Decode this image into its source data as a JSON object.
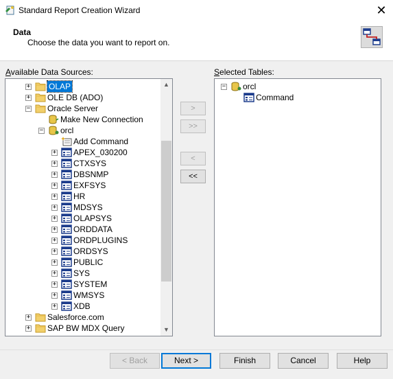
{
  "window": {
    "title": "Standard Report Creation Wizard",
    "close_glyph": "✕"
  },
  "header": {
    "title": "Data",
    "subtitle": "Choose the data you want to report on."
  },
  "available": {
    "label_accel": "A",
    "label_rest": "vailable Data Sources:",
    "items": [
      {
        "label": "OLAP",
        "type": "folder",
        "expander": "+"
      },
      {
        "label": "OLE DB (ADO)",
        "type": "folder",
        "expander": "+"
      },
      {
        "label": "Oracle Server",
        "type": "folder",
        "expander": "−"
      },
      {
        "label": "Make New Connection",
        "type": "make-connection"
      },
      {
        "label": "orcl",
        "type": "database",
        "expander": "−"
      },
      {
        "label": "Add Command",
        "type": "add-command"
      },
      {
        "label": "APEX_030200",
        "type": "table",
        "expander": "+"
      },
      {
        "label": "CTXSYS",
        "type": "table",
        "expander": "+"
      },
      {
        "label": "DBSNMP",
        "type": "table",
        "expander": "+"
      },
      {
        "label": "EXFSYS",
        "type": "table",
        "expander": "+"
      },
      {
        "label": "HR",
        "type": "table",
        "expander": "+"
      },
      {
        "label": "MDSYS",
        "type": "table",
        "expander": "+"
      },
      {
        "label": "OLAPSYS",
        "type": "table",
        "expander": "+"
      },
      {
        "label": "ORDDATA",
        "type": "table",
        "expander": "+"
      },
      {
        "label": "ORDPLUGINS",
        "type": "table",
        "expander": "+"
      },
      {
        "label": "ORDSYS",
        "type": "table",
        "expander": "+"
      },
      {
        "label": "PUBLIC",
        "type": "table",
        "expander": "+"
      },
      {
        "label": "SYS",
        "type": "table",
        "expander": "+"
      },
      {
        "label": "SYSTEM",
        "type": "table",
        "expander": "+"
      },
      {
        "label": "WMSYS",
        "type": "table",
        "expander": "+"
      },
      {
        "label": "XDB",
        "type": "table",
        "expander": "+"
      },
      {
        "label": "Salesforce.com",
        "type": "folder",
        "expander": "+"
      },
      {
        "label": "SAP BW MDX Query",
        "type": "folder",
        "expander": "+"
      }
    ]
  },
  "selected": {
    "label_accel": "S",
    "label_rest": "elected Tables:",
    "items": [
      {
        "label": "orcl",
        "type": "database",
        "expander": "−"
      },
      {
        "label": "Command",
        "type": "table"
      }
    ]
  },
  "move_buttons": {
    "add": ">",
    "add_all": ">>",
    "remove": "<",
    "remove_all": "<<"
  },
  "footer": {
    "back": "< Back",
    "next": "Next >",
    "finish": "Finish",
    "cancel": "Cancel",
    "help": "Help"
  }
}
